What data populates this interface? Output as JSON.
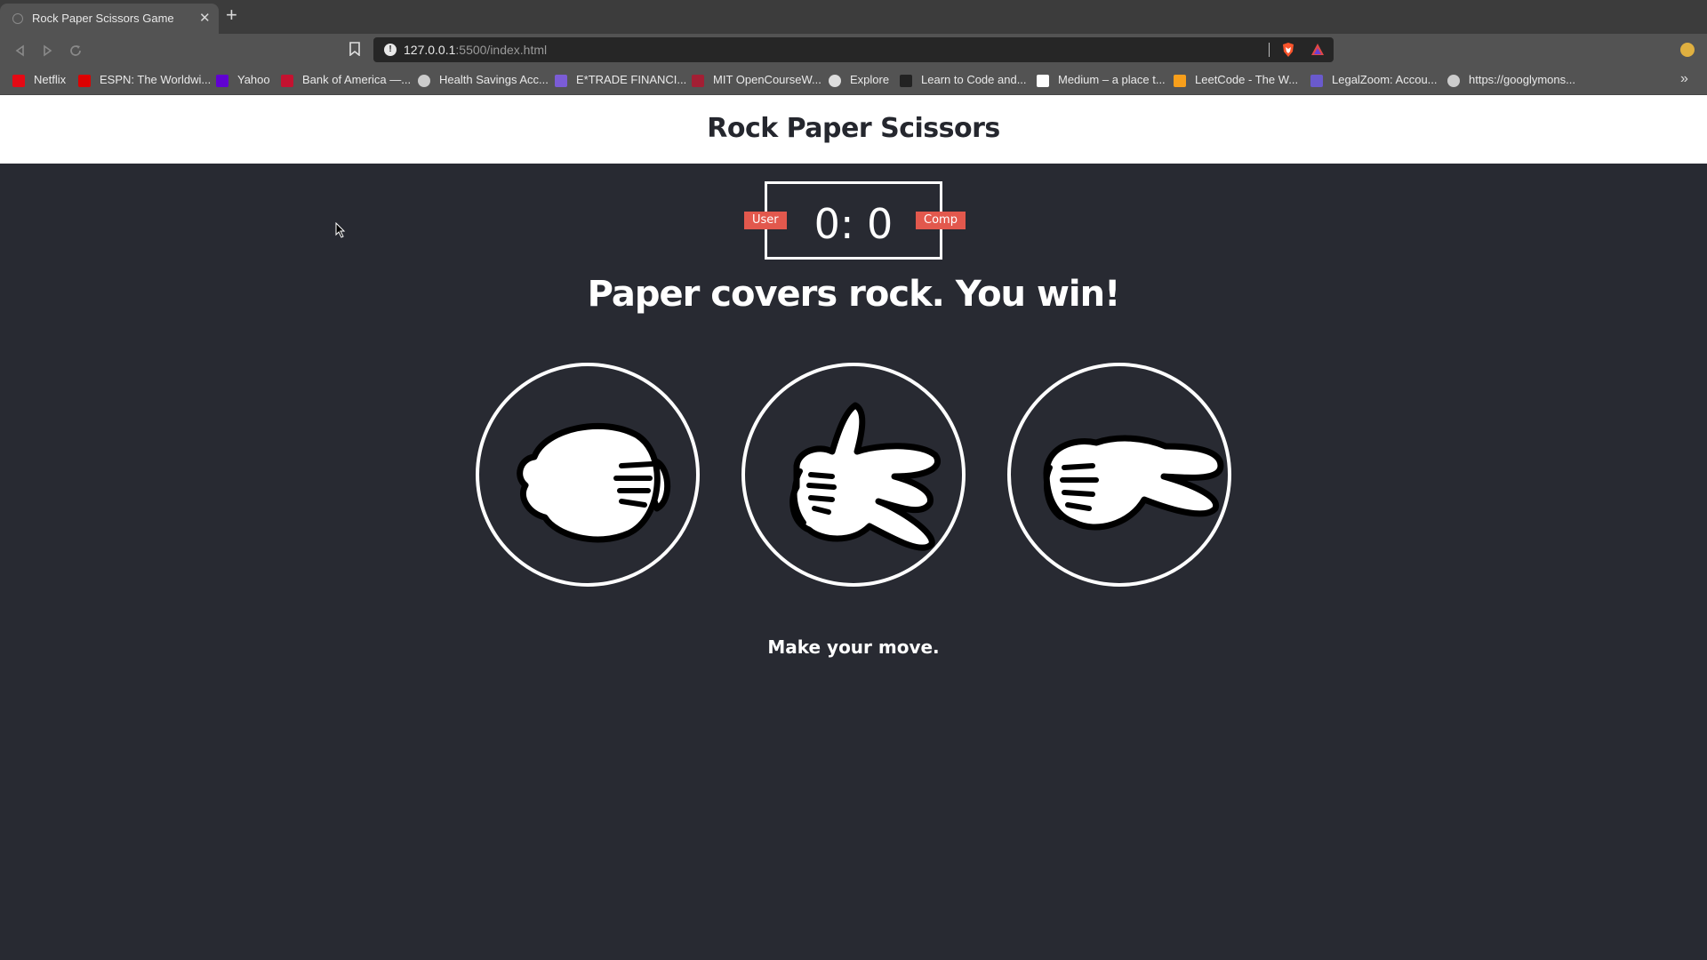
{
  "browser": {
    "tab_title": "Rock Paper Scissors Game",
    "url_host": "127.0.0.1",
    "url_path": ":5500/index.html",
    "bookmarks": [
      {
        "label": "Netflix",
        "icon": "netflix-icon",
        "color": "#e50914"
      },
      {
        "label": "ESPN: The Worldwi...",
        "icon": "espn-icon",
        "color": "#d00"
      },
      {
        "label": "Yahoo",
        "icon": "yahoo-icon",
        "color": "#6001d2"
      },
      {
        "label": "Bank of America —...",
        "icon": "bofa-icon",
        "color": "#c41230"
      },
      {
        "label": "Health Savings Acc...",
        "icon": "globe-icon",
        "color": "#cccccc"
      },
      {
        "label": "E*TRADE FINANCI...",
        "icon": "etrade-icon",
        "color": "#7b5cd6"
      },
      {
        "label": "MIT OpenCourseW...",
        "icon": "mit-icon",
        "color": "#a31f34"
      },
      {
        "label": "Explore",
        "icon": "github-icon",
        "color": "#dddddd"
      },
      {
        "label": "Learn to Code and...",
        "icon": "freecodecamp-icon",
        "color": "#222222"
      },
      {
        "label": "Medium – a place t...",
        "icon": "medium-icon",
        "color": "#ffffff"
      },
      {
        "label": "LeetCode - The W...",
        "icon": "leetcode-icon",
        "color": "#f89f1b"
      },
      {
        "label": "LegalZoom: Accou...",
        "icon": "legalzoom-icon",
        "color": "#6a5acd"
      },
      {
        "label": "https://googlymons...",
        "icon": "globe-icon",
        "color": "#cccccc"
      }
    ]
  },
  "page": {
    "title": "Rock Paper Scissors",
    "user_label": "User",
    "comp_label": "Comp",
    "score": "0: 0",
    "result": "Paper covers rock. You win!",
    "action_message": "Make your move.",
    "choices": [
      {
        "name": "rock",
        "icon": "rock-hand-icon"
      },
      {
        "name": "paper",
        "icon": "paper-hand-icon"
      },
      {
        "name": "scissors",
        "icon": "scissors-hand-icon"
      }
    ]
  },
  "colors": {
    "background": "#282a32",
    "badge": "#e2584d",
    "header": "#ffffff"
  }
}
